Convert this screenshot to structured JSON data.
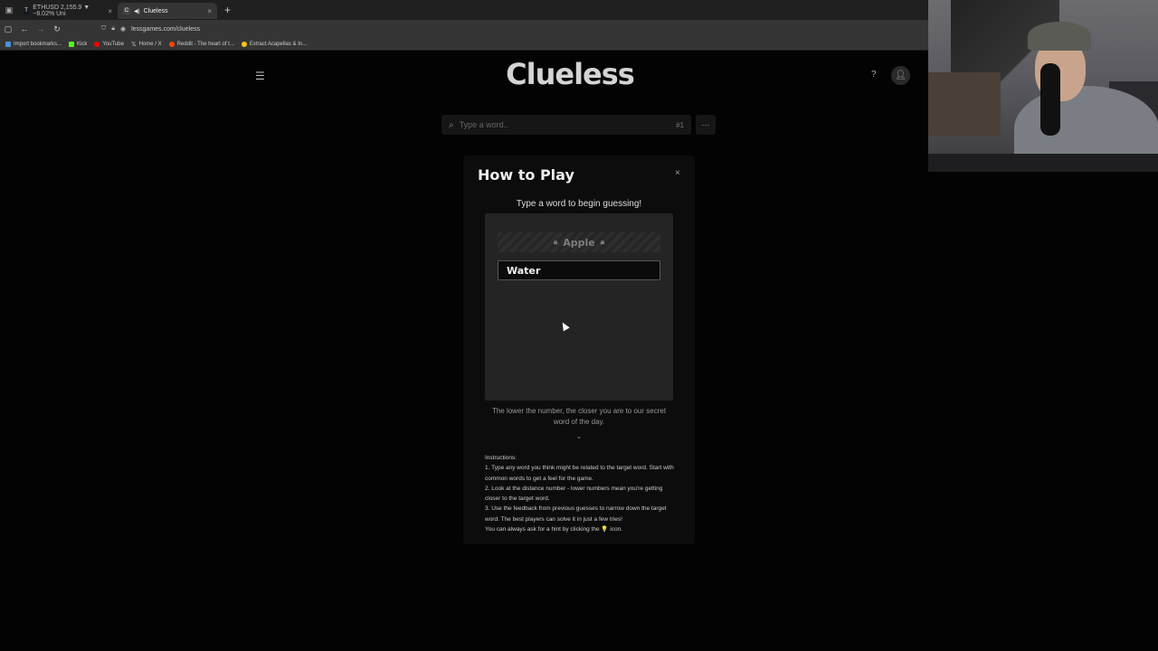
{
  "browser": {
    "tabs": [
      {
        "title": "ETHUSD 2,155.9 ▼ −8.02% Uni",
        "active": false,
        "favicon": "tradingview-icon"
      },
      {
        "title": "Clueless",
        "active": true,
        "favicon": "clueless-icon"
      }
    ],
    "new_tab": "+",
    "url": "lessgames.com/clueless",
    "bookmarks": [
      {
        "label": "Import bookmarks...",
        "color": "#4a90d9"
      },
      {
        "label": "Kick",
        "color": "#53fc18"
      },
      {
        "label": "YouTube",
        "color": "#ff0000"
      },
      {
        "label": "Home / X",
        "color": "#ffffff"
      },
      {
        "label": "Reddit - The heart of t...",
        "color": "#ff4500"
      },
      {
        "label": "Extract Acapellas & In...",
        "color": "#f5c518"
      }
    ]
  },
  "header": {
    "logo": "Clueless",
    "help": "?"
  },
  "search": {
    "placeholder": "Type a word..",
    "guess_number": "#1",
    "more": "···"
  },
  "modal": {
    "title": "How to Play",
    "close": "×",
    "subtitle": "Type a word to begin guessing!",
    "demo_locked_word": "Apple",
    "demo_input_word": "Water",
    "caption": "The lower the number, the closer you are to our secret word of the day.",
    "chevron": "⌄",
    "instructions": [
      "Instructions:",
      "1. Type any word you think might be related to the target word. Start with common words to get a feel for the game.",
      "2. Look at the distance number - lower numbers mean you're getting closer to the target word.",
      "3. Use the feedback from previous guesses to narrow down the target word. The best players can solve it in just a few tries!",
      "You can always ask for a hint by clicking the 💡 icon."
    ]
  }
}
